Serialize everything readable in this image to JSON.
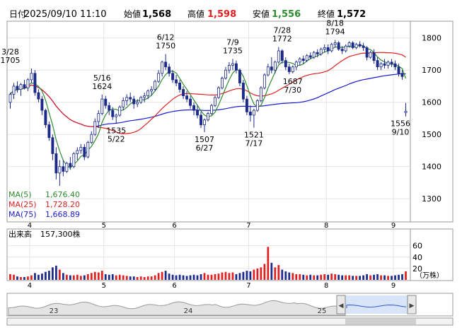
{
  "header": {
    "datetime_label": "日付",
    "datetime": "2025/09/10 11:10",
    "open_label": "始値",
    "open": "1,568",
    "high_label": "高値",
    "high": "1,598",
    "low_label": "安値",
    "low": "1,556",
    "close_label": "終値",
    "close": "1,572"
  },
  "legend": {
    "ma5_label": "MA(5)",
    "ma5_value": "1,676.40",
    "ma25_label": "MA(25)",
    "ma25_value": "1,728.20",
    "ma75_label": "MA(75)",
    "ma75_value": "1,668.89"
  },
  "volume_header": {
    "label": "出来高",
    "value": "157,300株"
  },
  "volume_unit": "（万株）",
  "colors": {
    "up": "#ffffff",
    "down": "#1c2a8a",
    "ma5": "#2e8b2e",
    "ma25": "#e02020",
    "ma75": "#1a1ad0",
    "volume_up": "#e02020",
    "volume_down": "#1c2a8a",
    "high": "#e02020",
    "low": "#2e8b2e"
  },
  "navigator": {
    "labels": [
      "23",
      "24",
      "25"
    ],
    "left_handle": "◀",
    "right_handle": "▶"
  },
  "chart_data": {
    "type": "candlestick",
    "price_axis": {
      "ylim": [
        1230,
        1850
      ],
      "ticks": [
        1300,
        1400,
        1500,
        1600,
        1700,
        1800
      ]
    },
    "volume_axis": {
      "ylim": [
        0,
        72
      ],
      "ticks": [
        20,
        40,
        60
      ]
    },
    "month_ticks": [
      {
        "label": "4",
        "day": 6
      },
      {
        "label": "5",
        "day": 27
      },
      {
        "label": "6",
        "day": 47
      },
      {
        "label": "7",
        "day": 68
      },
      {
        "label": "8",
        "day": 90
      },
      {
        "label": "9",
        "day": 109
      }
    ],
    "annotations": [
      {
        "text": "3/28",
        "value": "1705",
        "day": 0,
        "price": 1705,
        "pos": "above"
      },
      {
        "text": "5/16",
        "value": "1624",
        "day": 26,
        "price": 1624,
        "pos": "above"
      },
      {
        "text": "6/12",
        "value": "1750",
        "day": 44,
        "price": 1750,
        "pos": "above"
      },
      {
        "text": "7/9",
        "value": "1735",
        "day": 63,
        "price": 1735,
        "pos": "above"
      },
      {
        "text": "7/28",
        "value": "1772",
        "day": 77,
        "price": 1772,
        "pos": "above"
      },
      {
        "text": "8/18",
        "value": "1794",
        "day": 92,
        "price": 1794,
        "pos": "above"
      },
      {
        "text": "5/22",
        "value": "1535",
        "day": 30,
        "price": 1535,
        "pos": "below"
      },
      {
        "text": "6/27",
        "value": "1507",
        "day": 55,
        "price": 1507,
        "pos": "below"
      },
      {
        "text": "7/17",
        "value": "1521",
        "day": 69,
        "price": 1521,
        "pos": "below"
      },
      {
        "text": "7/30",
        "value": "1687",
        "day": 80,
        "price": 1687,
        "pos": "below"
      },
      {
        "text": "9/10",
        "value": "1556",
        "day": 116,
        "price": 1556,
        "pos": "below"
      }
    ],
    "candles": [
      [
        1600,
        1630,
        1580,
        1625,
        10
      ],
      [
        1625,
        1660,
        1610,
        1650,
        9
      ],
      [
        1650,
        1665,
        1630,
        1640,
        6
      ],
      [
        1640,
        1660,
        1620,
        1655,
        5
      ],
      [
        1655,
        1670,
        1640,
        1645,
        5
      ],
      [
        1645,
        1675,
        1635,
        1670,
        6
      ],
      [
        1670,
        1705,
        1660,
        1690,
        8
      ],
      [
        1690,
        1700,
        1620,
        1630,
        12
      ],
      [
        1630,
        1640,
        1600,
        1610,
        9
      ],
      [
        1610,
        1620,
        1560,
        1575,
        11
      ],
      [
        1575,
        1580,
        1520,
        1530,
        14
      ],
      [
        1530,
        1540,
        1480,
        1490,
        16
      ],
      [
        1490,
        1500,
        1420,
        1440,
        22
      ],
      [
        1440,
        1460,
        1360,
        1380,
        25
      ],
      [
        1380,
        1420,
        1340,
        1400,
        18
      ],
      [
        1400,
        1420,
        1370,
        1385,
        12
      ],
      [
        1385,
        1415,
        1380,
        1410,
        9
      ],
      [
        1410,
        1430,
        1390,
        1400,
        8
      ],
      [
        1400,
        1445,
        1395,
        1440,
        8
      ],
      [
        1440,
        1460,
        1420,
        1450,
        9
      ],
      [
        1450,
        1470,
        1440,
        1460,
        7
      ],
      [
        1460,
        1470,
        1420,
        1430,
        8
      ],
      [
        1430,
        1480,
        1425,
        1475,
        10
      ],
      [
        1475,
        1510,
        1470,
        1500,
        12
      ],
      [
        1500,
        1550,
        1495,
        1540,
        14
      ],
      [
        1540,
        1575,
        1520,
        1565,
        13
      ],
      [
        1565,
        1624,
        1560,
        1610,
        16
      ],
      [
        1610,
        1620,
        1580,
        1590,
        10
      ],
      [
        1590,
        1600,
        1560,
        1575,
        9
      ],
      [
        1575,
        1585,
        1545,
        1555,
        10
      ],
      [
        1555,
        1565,
        1535,
        1560,
        8
      ],
      [
        1560,
        1590,
        1555,
        1585,
        9
      ],
      [
        1585,
        1615,
        1575,
        1605,
        8
      ],
      [
        1605,
        1625,
        1590,
        1615,
        7
      ],
      [
        1615,
        1630,
        1600,
        1610,
        6
      ],
      [
        1610,
        1620,
        1580,
        1595,
        6
      ],
      [
        1595,
        1610,
        1585,
        1600,
        5
      ],
      [
        1600,
        1620,
        1595,
        1615,
        6
      ],
      [
        1615,
        1630,
        1600,
        1620,
        5
      ],
      [
        1620,
        1640,
        1610,
        1635,
        6
      ],
      [
        1635,
        1650,
        1620,
        1640,
        6
      ],
      [
        1640,
        1670,
        1635,
        1665,
        8
      ],
      [
        1665,
        1700,
        1660,
        1690,
        12
      ],
      [
        1690,
        1730,
        1680,
        1725,
        14
      ],
      [
        1725,
        1750,
        1700,
        1710,
        16
      ],
      [
        1710,
        1720,
        1680,
        1690,
        11
      ],
      [
        1690,
        1700,
        1660,
        1670,
        9
      ],
      [
        1670,
        1685,
        1650,
        1660,
        8
      ],
      [
        1660,
        1670,
        1630,
        1640,
        9
      ],
      [
        1640,
        1650,
        1610,
        1620,
        8
      ],
      [
        1620,
        1635,
        1600,
        1610,
        7
      ],
      [
        1610,
        1620,
        1580,
        1590,
        8
      ],
      [
        1590,
        1600,
        1560,
        1575,
        9
      ],
      [
        1575,
        1590,
        1550,
        1560,
        8
      ],
      [
        1560,
        1570,
        1520,
        1530,
        10
      ],
      [
        1530,
        1550,
        1507,
        1545,
        12
      ],
      [
        1545,
        1570,
        1540,
        1565,
        9
      ],
      [
        1565,
        1595,
        1560,
        1590,
        9
      ],
      [
        1590,
        1620,
        1585,
        1615,
        10
      ],
      [
        1615,
        1650,
        1610,
        1645,
        11
      ],
      [
        1645,
        1680,
        1640,
        1675,
        13
      ],
      [
        1675,
        1710,
        1670,
        1700,
        14
      ],
      [
        1700,
        1725,
        1690,
        1715,
        12
      ],
      [
        1715,
        1735,
        1700,
        1720,
        13
      ],
      [
        1720,
        1730,
        1690,
        1700,
        10
      ],
      [
        1700,
        1705,
        1650,
        1660,
        12
      ],
      [
        1660,
        1670,
        1600,
        1610,
        14
      ],
      [
        1610,
        1620,
        1560,
        1570,
        16
      ],
      [
        1570,
        1590,
        1540,
        1560,
        15
      ],
      [
        1560,
        1580,
        1521,
        1575,
        18
      ],
      [
        1575,
        1610,
        1570,
        1605,
        20
      ],
      [
        1605,
        1650,
        1600,
        1645,
        22
      ],
      [
        1645,
        1690,
        1640,
        1685,
        28
      ],
      [
        1685,
        1720,
        1680,
        1710,
        58
      ],
      [
        1710,
        1740,
        1690,
        1700,
        30
      ],
      [
        1700,
        1730,
        1690,
        1725,
        22
      ],
      [
        1725,
        1772,
        1720,
        1760,
        26
      ],
      [
        1760,
        1765,
        1720,
        1730,
        18
      ],
      [
        1730,
        1740,
        1700,
        1710,
        15
      ],
      [
        1710,
        1720,
        1687,
        1695,
        13
      ],
      [
        1695,
        1715,
        1690,
        1710,
        12
      ],
      [
        1710,
        1730,
        1700,
        1725,
        10
      ],
      [
        1725,
        1740,
        1715,
        1735,
        10
      ],
      [
        1735,
        1745,
        1720,
        1730,
        9
      ],
      [
        1730,
        1750,
        1725,
        1745,
        8
      ],
      [
        1745,
        1755,
        1735,
        1740,
        9
      ],
      [
        1740,
        1760,
        1735,
        1755,
        8
      ],
      [
        1755,
        1765,
        1740,
        1750,
        8
      ],
      [
        1750,
        1770,
        1745,
        1765,
        9
      ],
      [
        1765,
        1780,
        1755,
        1770,
        10
      ],
      [
        1770,
        1780,
        1750,
        1760,
        9
      ],
      [
        1760,
        1785,
        1755,
        1780,
        11
      ],
      [
        1780,
        1794,
        1770,
        1785,
        10
      ],
      [
        1785,
        1790,
        1760,
        1765,
        9
      ],
      [
        1765,
        1775,
        1750,
        1760,
        8
      ],
      [
        1760,
        1780,
        1755,
        1775,
        8
      ],
      [
        1775,
        1790,
        1770,
        1785,
        8
      ],
      [
        1785,
        1790,
        1765,
        1770,
        7
      ],
      [
        1770,
        1785,
        1765,
        1780,
        7
      ],
      [
        1780,
        1790,
        1770,
        1775,
        7
      ],
      [
        1775,
        1785,
        1760,
        1770,
        8
      ],
      [
        1770,
        1775,
        1730,
        1740,
        10
      ],
      [
        1740,
        1760,
        1735,
        1755,
        8
      ],
      [
        1755,
        1765,
        1720,
        1730,
        9
      ],
      [
        1730,
        1740,
        1700,
        1710,
        10
      ],
      [
        1710,
        1725,
        1700,
        1720,
        8
      ],
      [
        1720,
        1735,
        1705,
        1715,
        8
      ],
      [
        1715,
        1730,
        1705,
        1725,
        7
      ],
      [
        1725,
        1735,
        1710,
        1720,
        7
      ],
      [
        1720,
        1730,
        1700,
        1710,
        8
      ],
      [
        1710,
        1720,
        1680,
        1690,
        9
      ],
      [
        1690,
        1700,
        1670,
        1680,
        10
      ],
      [
        1568,
        1598,
        1556,
        1572,
        15
      ]
    ]
  }
}
